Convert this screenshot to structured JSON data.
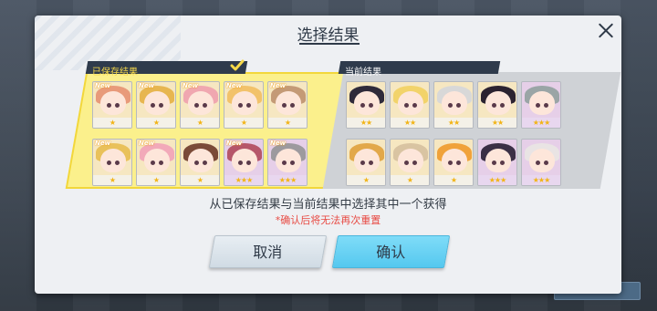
{
  "dialog": {
    "title": "选择结果",
    "hint": "从已保存结果与当前结果中选择其中一个获得",
    "warning": "*确认后将无法再次重置",
    "cancel_label": "取消",
    "confirm_label": "确认"
  },
  "saved": {
    "label": "已保存结果",
    "selected": true,
    "cards": [
      {
        "badge": "New",
        "stars": "★",
        "hair": "#e89a7a",
        "bg": "#f6e7c1"
      },
      {
        "badge": "New",
        "stars": "★",
        "hair": "#e7b650",
        "bg": "#f6e7c1"
      },
      {
        "badge": "New",
        "stars": "★",
        "hair": "#f0a7b0",
        "bg": "#f6e7c1"
      },
      {
        "badge": "New",
        "stars": "★",
        "hair": "#f2c26a",
        "bg": "#f6e7c1"
      },
      {
        "badge": "New",
        "stars": "★",
        "hair": "#c49a76",
        "bg": "#f6e7c1"
      },
      {
        "badge": "New",
        "stars": "★",
        "hair": "#e9c15a",
        "bg": "#f6e7c1"
      },
      {
        "badge": "New",
        "stars": "★",
        "hair": "#f2a9b9",
        "bg": "#f6e7c1"
      },
      {
        "badge": "",
        "stars": "★",
        "hair": "#7a4a38",
        "bg": "#f6e7c1"
      },
      {
        "badge": "New",
        "stars": "★★★",
        "hair": "#b6566a",
        "bg": "#e6cfe8"
      },
      {
        "badge": "New",
        "stars": "★★★",
        "hair": "#9d9a9e",
        "bg": "#e6cfe8"
      }
    ]
  },
  "current": {
    "label": "当前结果",
    "cards": [
      {
        "badge": "",
        "stars": "★★",
        "hair": "#2f2a3a",
        "bg": "#f6e7c1"
      },
      {
        "badge": "",
        "stars": "★★",
        "hair": "#f2d36a",
        "bg": "#f6e7c1"
      },
      {
        "badge": "",
        "stars": "★★",
        "hair": "#d8d8d8",
        "bg": "#f6e7c1"
      },
      {
        "badge": "",
        "stars": "★★",
        "hair": "#2b2230",
        "bg": "#f6e7c1"
      },
      {
        "badge": "",
        "stars": "★★★",
        "hair": "#9aa5a6",
        "bg": "#e6cfe8"
      },
      {
        "badge": "",
        "stars": "★",
        "hair": "#e2a84a",
        "bg": "#f6e7c1"
      },
      {
        "badge": "",
        "stars": "★",
        "hair": "#d9c4a2",
        "bg": "#f6e7c1"
      },
      {
        "badge": "",
        "stars": "★",
        "hair": "#f0a23a",
        "bg": "#f6e7c1"
      },
      {
        "badge": "",
        "stars": "★★★",
        "hair": "#3a2f45",
        "bg": "#e6cfe8"
      },
      {
        "badge": "",
        "stars": "★★★",
        "hair": "#e9e4e4",
        "bg": "#e6cfe8"
      }
    ]
  }
}
